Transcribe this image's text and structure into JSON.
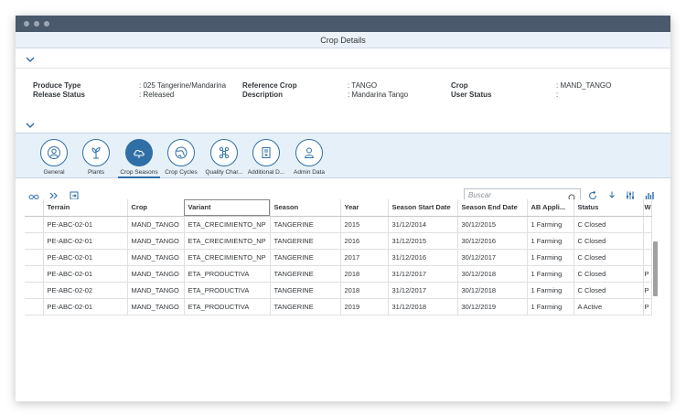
{
  "header": {
    "title": "Crop Details"
  },
  "attributes": [
    {
      "label": "Produce Type",
      "value": ": 025 Tangerine/Mandarina"
    },
    {
      "label": "Release Status",
      "value": ": Released"
    },
    {
      "label": "Reference Crop",
      "value": ": TANGO"
    },
    {
      "label": "Description",
      "value": ": Mandarina Tango"
    },
    {
      "label": "Crop",
      "value": ": MAND_TANGO"
    },
    {
      "label": "User Status",
      "value": ":"
    }
  ],
  "tabs": [
    {
      "label": "General",
      "icon": "person-circle-icon"
    },
    {
      "label": "Plants",
      "icon": "plant-icon"
    },
    {
      "label": "Crop Seasons",
      "icon": "cloud-icon"
    },
    {
      "label": "Crop Cycles",
      "icon": "globe-icon"
    },
    {
      "label": "Quality Char...",
      "icon": "molecule-icon"
    },
    {
      "label": "Additional D...",
      "icon": "document-icon"
    },
    {
      "label": "Admin Data",
      "icon": "admin-person-icon"
    }
  ],
  "active_tab": "Crop Seasons",
  "search": {
    "placeholder": "Buscar"
  },
  "table": {
    "columns": [
      "Terrain",
      "Crop",
      "Variant",
      "Season",
      "Year",
      "Season Start Date",
      "Season End Date",
      "AB Appli...",
      "Status",
      "W"
    ],
    "rows": [
      [
        "PE-ABC-02-01",
        "MAND_TANGO",
        "ETA_CRECIMIENTO_NP",
        "TANGERINE",
        "2015",
        "31/12/2014",
        "30/12/2015",
        "1 Farming",
        "C Closed",
        ""
      ],
      [
        "PE-ABC-02-01",
        "MAND_TANGO",
        "ETA_CRECIMIENTO_NP",
        "TANGERINE",
        "2016",
        "31/12/2015",
        "30/12/2016",
        "1 Farming",
        "C Closed",
        ""
      ],
      [
        "PE-ABC-02-01",
        "MAND_TANGO",
        "ETA_CRECIMIENTO_NP",
        "TANGERINE",
        "2017",
        "31/12/2016",
        "30/12/2017",
        "1 Farming",
        "C Closed",
        ""
      ],
      [
        "PE-ABC-02-01",
        "MAND_TANGO",
        "ETA_PRODUCTIVA",
        "TANGERINE",
        "2018",
        "31/12/2017",
        "30/12/2018",
        "1 Farming",
        "C Closed",
        "P"
      ],
      [
        "PE-ABC-02-02",
        "MAND_TANGO",
        "ETA_PRODUCTIVA",
        "TANGERINE",
        "2018",
        "31/12/2017",
        "30/12/2018",
        "1 Farming",
        "C Closed",
        "P"
      ],
      [
        "PE-ABC-02-01",
        "MAND_TANGO",
        "ETA_PRODUCTIVA",
        "TANGERINE",
        "2019",
        "31/12/2018",
        "30/12/2019",
        "1 Farming",
        "A Active",
        "P"
      ]
    ]
  },
  "colors": {
    "accent": "#2f6fa6",
    "titlebar": "#4a5a6c",
    "tabbar": "#e6f0f8"
  }
}
